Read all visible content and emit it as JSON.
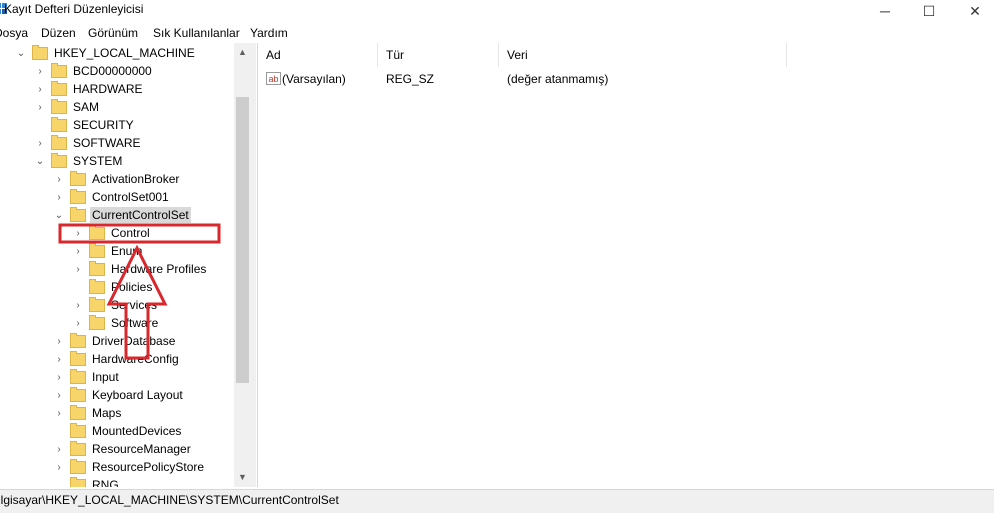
{
  "window": {
    "title": "Kayıt Defteri Düzenleyicisi",
    "minimize_glyph": "─",
    "maximize_glyph": "☐",
    "close_glyph": "✕"
  },
  "menu": [
    "Dosya",
    "Düzen",
    "Görünüm",
    "Sık Kullanılanlar",
    "Yardım"
  ],
  "tree": [
    {
      "label": "HKEY_LOCAL_MACHINE",
      "expander": "⌄"
    },
    {
      "label": "BCD00000000",
      "expander": "›"
    },
    {
      "label": "HARDWARE",
      "expander": "›"
    },
    {
      "label": "SAM",
      "expander": "›"
    },
    {
      "label": "SECURITY",
      "expander": ""
    },
    {
      "label": "SOFTWARE",
      "expander": "›"
    },
    {
      "label": "SYSTEM",
      "expander": "⌄"
    },
    {
      "label": "ActivationBroker",
      "expander": "›"
    },
    {
      "label": "ControlSet001",
      "expander": "›"
    },
    {
      "label": "CurrentControlSet",
      "expander": "⌄"
    },
    {
      "label": "Control",
      "expander": "›"
    },
    {
      "label": "Enum",
      "expander": "›"
    },
    {
      "label": "Hardware Profiles",
      "expander": "›"
    },
    {
      "label": "Policies",
      "expander": ""
    },
    {
      "label": "Services",
      "expander": "›"
    },
    {
      "label": "Software",
      "expander": "›"
    },
    {
      "label": "DriverDatabase",
      "expander": "›"
    },
    {
      "label": "HardwareConfig",
      "expander": "›"
    },
    {
      "label": "Input",
      "expander": "›"
    },
    {
      "label": "Keyboard Layout",
      "expander": "›"
    },
    {
      "label": "Maps",
      "expander": "›"
    },
    {
      "label": "MountedDevices",
      "expander": ""
    },
    {
      "label": "ResourceManager",
      "expander": "›"
    },
    {
      "label": "ResourcePolicyStore",
      "expander": "›"
    },
    {
      "label": "RNG",
      "expander": ""
    }
  ],
  "list": {
    "headers": {
      "name": "Ad",
      "type": "Tür",
      "data": "Veri"
    },
    "rows": [
      {
        "name": "(Varsayılan)",
        "type": "REG_SZ",
        "data": "(değer atanmamış)",
        "icon_text": "ab"
      }
    ]
  },
  "scroll": {
    "up": "▲",
    "down": "▼"
  },
  "status": "ilgisayar\\HKEY_LOCAL_MACHINE\\SYSTEM\\CurrentControlSet",
  "colors": {
    "annotation": "#d9272e",
    "selection": "#d9d9d9",
    "folder": "#f7d56a"
  }
}
